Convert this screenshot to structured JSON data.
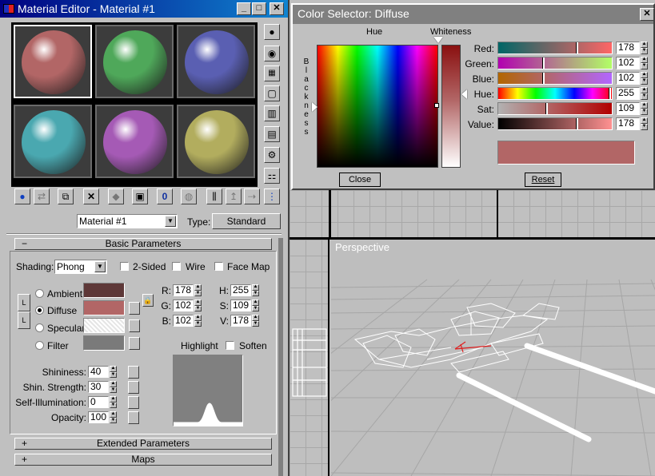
{
  "material_editor": {
    "title": "Material Editor - Material #1",
    "material_name": "Material #1",
    "type_label": "Type:",
    "type_value": "Standard",
    "rollouts": {
      "basic": "Basic Parameters",
      "extended": "Extended Parameters",
      "maps": "Maps",
      "minus": "−",
      "plus": "+"
    },
    "shading_label": "Shading:",
    "shading_value": "Phong",
    "two_sided": "2-Sided",
    "wire": "Wire",
    "face_map": "Face Map",
    "ambient": "Ambient",
    "diffuse": "Diffuse",
    "specular": "Specular",
    "filter": "Filter",
    "lock_glyph": "L",
    "rgb": [
      {
        "label": "R:",
        "value": "178"
      },
      {
        "label": "G:",
        "value": "102"
      },
      {
        "label": "B:",
        "value": "102"
      }
    ],
    "hsv": [
      {
        "label": "H:",
        "value": "255"
      },
      {
        "label": "S:",
        "value": "109"
      },
      {
        "label": "V:",
        "value": "178"
      }
    ],
    "highlight": "Highlight",
    "soften": "Soften",
    "params": [
      {
        "label": "Shininess:",
        "value": "40"
      },
      {
        "label": "Shin. Strength:",
        "value": "30"
      },
      {
        "label": "Self-Illumination:",
        "value": "0"
      },
      {
        "label": "Opacity:",
        "value": "100"
      }
    ],
    "swatch_colors": {
      "ambient": "#5e3838",
      "diffuse": "#b26666",
      "specular": "#e5e5e5",
      "filter": "#7a7a7a"
    },
    "sample_spheres": [
      {
        "color": "#b26666"
      },
      {
        "color": "#4fa85a"
      },
      {
        "color": "#5a5fb2"
      },
      {
        "color": "#4aa8b0"
      },
      {
        "color": "#a55ab5"
      },
      {
        "color": "#b2ad5e"
      }
    ]
  },
  "color_selector": {
    "title": "Color Selector: Diffuse",
    "hue_label": "Hue",
    "whiteness_label": "Whiteness",
    "blackness_label": "Blackness",
    "close_label": "Close",
    "reset_label": "Reset",
    "preview_color": "#b26666",
    "sliders": [
      {
        "label": "Red:",
        "value": "178",
        "level": 0.7
      },
      {
        "label": "Green:",
        "value": "102",
        "level": 0.4
      },
      {
        "label": "Blue:",
        "value": "102",
        "level": 0.4
      },
      {
        "label": "Hue:",
        "value": "255",
        "level": 1.0
      },
      {
        "label": "Sat:",
        "value": "109",
        "level": 0.43
      },
      {
        "label": "Value:",
        "value": "178",
        "level": 0.7
      }
    ]
  },
  "viewport": {
    "label": "Perspective"
  }
}
